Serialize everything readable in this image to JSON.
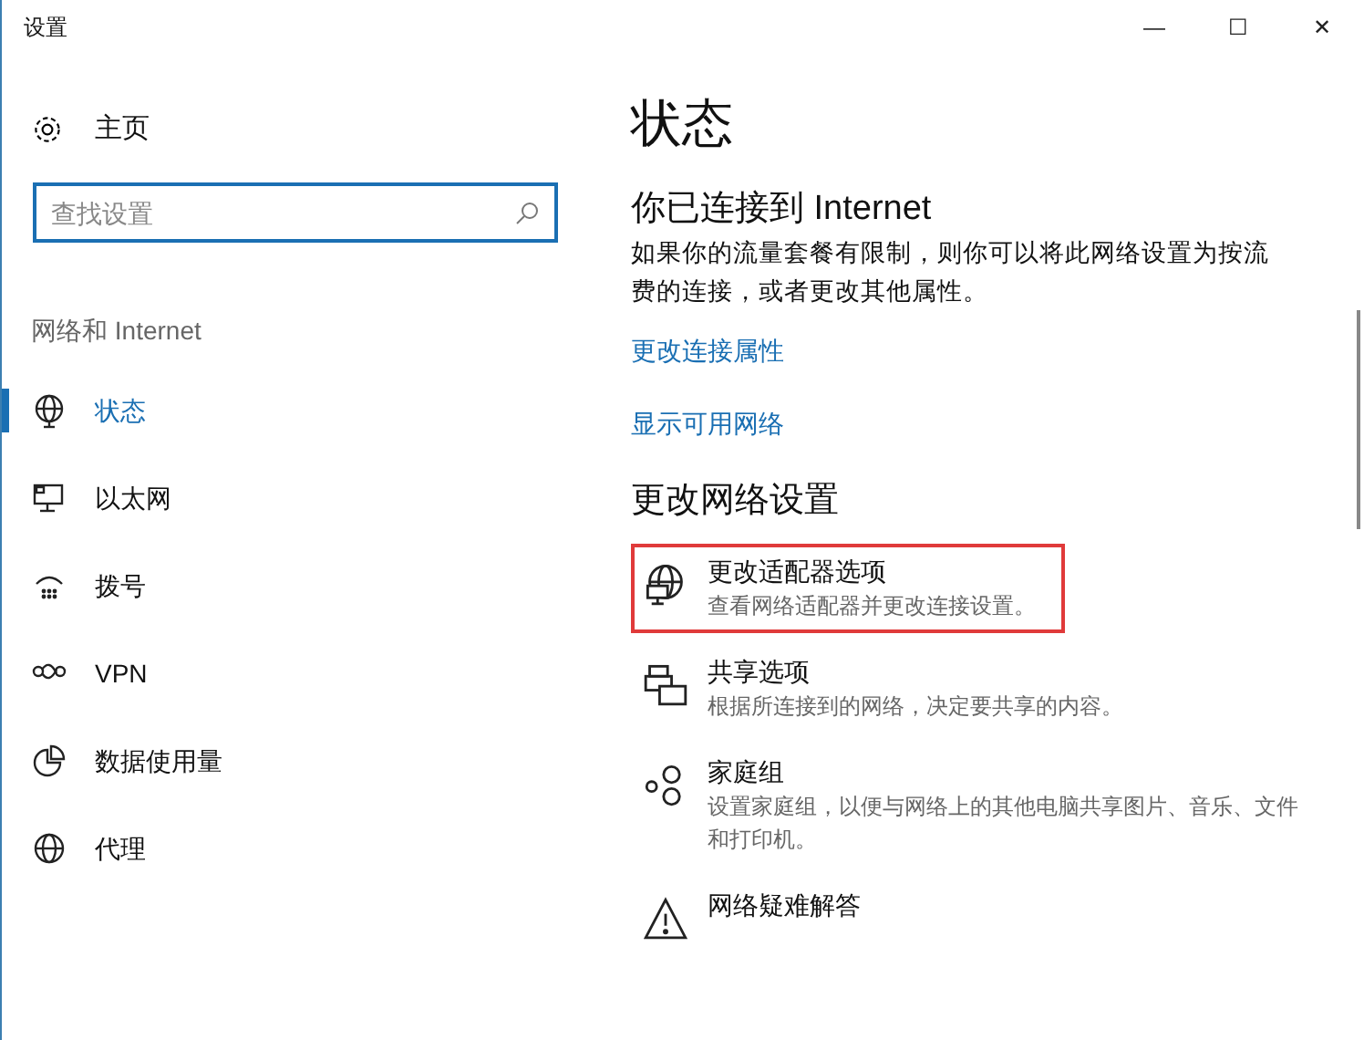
{
  "window": {
    "title": "设置",
    "controls": [
      "—",
      "☐",
      "✕"
    ]
  },
  "sidebar": {
    "home": "主页",
    "search": {
      "placeholder": "查找设置"
    },
    "section": "网络和 Internet",
    "items": [
      {
        "label": "状态",
        "selected": true
      },
      {
        "label": "以太网",
        "selected": false
      },
      {
        "label": "拨号",
        "selected": false
      },
      {
        "label": "VPN",
        "selected": false
      },
      {
        "label": "数据使用量",
        "selected": false
      },
      {
        "label": "代理",
        "selected": false
      }
    ]
  },
  "content": {
    "title": "状态",
    "connection": {
      "heading": "你已连接到 Internet",
      "description_lines": [
        "如果你的流量套餐有限制，则你可以将此网络设置为按流",
        "费的连接，或者更改其他属性。"
      ]
    },
    "links": [
      "更改连接属性",
      "显示可用网络"
    ],
    "section": "更改网络设置",
    "options": [
      {
        "title": "更改适配器选项",
        "description": "查看网络适配器并更改连接设置。",
        "highlighted": true
      },
      {
        "title": "共享选项",
        "description": "根据所连接到的网络，决定要共享的内容。",
        "highlighted": false
      },
      {
        "title": "家庭组",
        "description": "设置家庭组，以便与网络上的其他电脑共享图片、音乐、文件和打印机。",
        "highlighted": false
      },
      {
        "title": "网络疑难解答",
        "highlighted": false
      }
    ]
  }
}
